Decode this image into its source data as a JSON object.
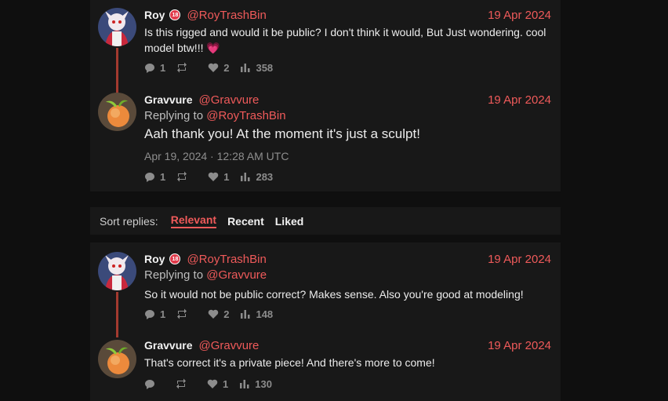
{
  "thread_top": {
    "reply1": {
      "name": "Roy",
      "badge": "18",
      "handle": "@RoyTrashBin",
      "date": "19 Apr 2024",
      "text": "Is this rigged and would it be public? I don't think it would, But Just wondering. cool model btw!!!",
      "emoji": "💗",
      "stats": {
        "replies": "1",
        "retweets": "",
        "likes": "2",
        "views": "358"
      }
    },
    "reply2": {
      "name": "Gravvure",
      "handle": "@Gravvure",
      "date": "19 Apr 2024",
      "replying_label": "Replying to",
      "replying_handle": "@RoyTrashBin",
      "text": "Aah thank you! At the moment it's just a sculpt!",
      "timestamp": "Apr 19, 2024 · 12:28 AM UTC",
      "stats": {
        "replies": "1",
        "retweets": "",
        "likes": "1",
        "views": "283"
      }
    }
  },
  "sort": {
    "label": "Sort replies:",
    "options": [
      "Relevant",
      "Recent",
      "Liked"
    ],
    "active": "Relevant"
  },
  "thread_bottom": {
    "reply1": {
      "name": "Roy",
      "badge": "18",
      "handle": "@RoyTrashBin",
      "date": "19 Apr 2024",
      "replying_label": "Replying to",
      "replying_handle": "@Gravvure",
      "text": "So it would not be public correct? Makes sense. Also you're good at modeling!",
      "stats": {
        "replies": "1",
        "retweets": "",
        "likes": "2",
        "views": "148"
      }
    },
    "reply2": {
      "name": "Gravvure",
      "handle": "@Gravvure",
      "date": "19 Apr 2024",
      "text": "That's correct it's a private piece! And there's more to come!",
      "stats": {
        "replies": "",
        "retweets": "",
        "likes": "1",
        "views": "130"
      }
    }
  },
  "colors": {
    "accent": "#ef5a5a",
    "thread_line": "#a33a2f",
    "card": "#181818",
    "bg": "#0f0f0f"
  },
  "icons": [
    "comment-icon",
    "retweet-icon",
    "heart-icon",
    "views-icon"
  ]
}
